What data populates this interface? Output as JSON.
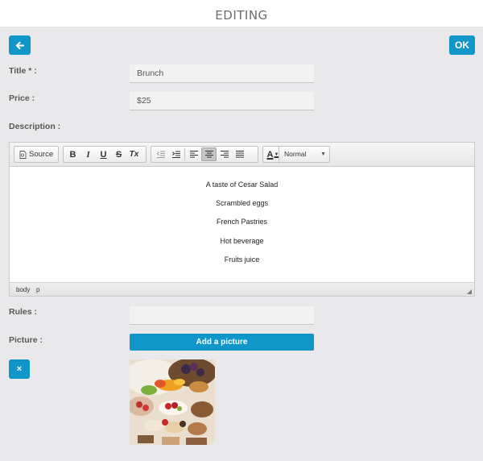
{
  "header": {
    "title": "EDITING"
  },
  "actions": {
    "ok_label": "OK",
    "close_label": "×"
  },
  "form": {
    "title_label": "Title * :",
    "title_value": "Brunch",
    "price_label": "Price :",
    "price_value": "$25",
    "description_label": "Description :",
    "rules_label": "Rules :",
    "rules_value": "",
    "picture_label": "Picture :",
    "add_picture_label": "Add a picture"
  },
  "editor": {
    "toolbar": {
      "source_label": "Source",
      "bold": "B",
      "italic": "I",
      "underline": "U",
      "strike": "S",
      "remove_format": "Tx",
      "text_color": "A",
      "format_value": "Normal"
    },
    "lines": [
      "A taste of Cesar Salad",
      "Scrambled eggs",
      "French Pastries",
      "Hot beverage",
      "Fruits juice"
    ],
    "path": [
      "body",
      "p"
    ]
  },
  "colors": {
    "accent": "#1096c8",
    "background": "#e9e9ec"
  }
}
